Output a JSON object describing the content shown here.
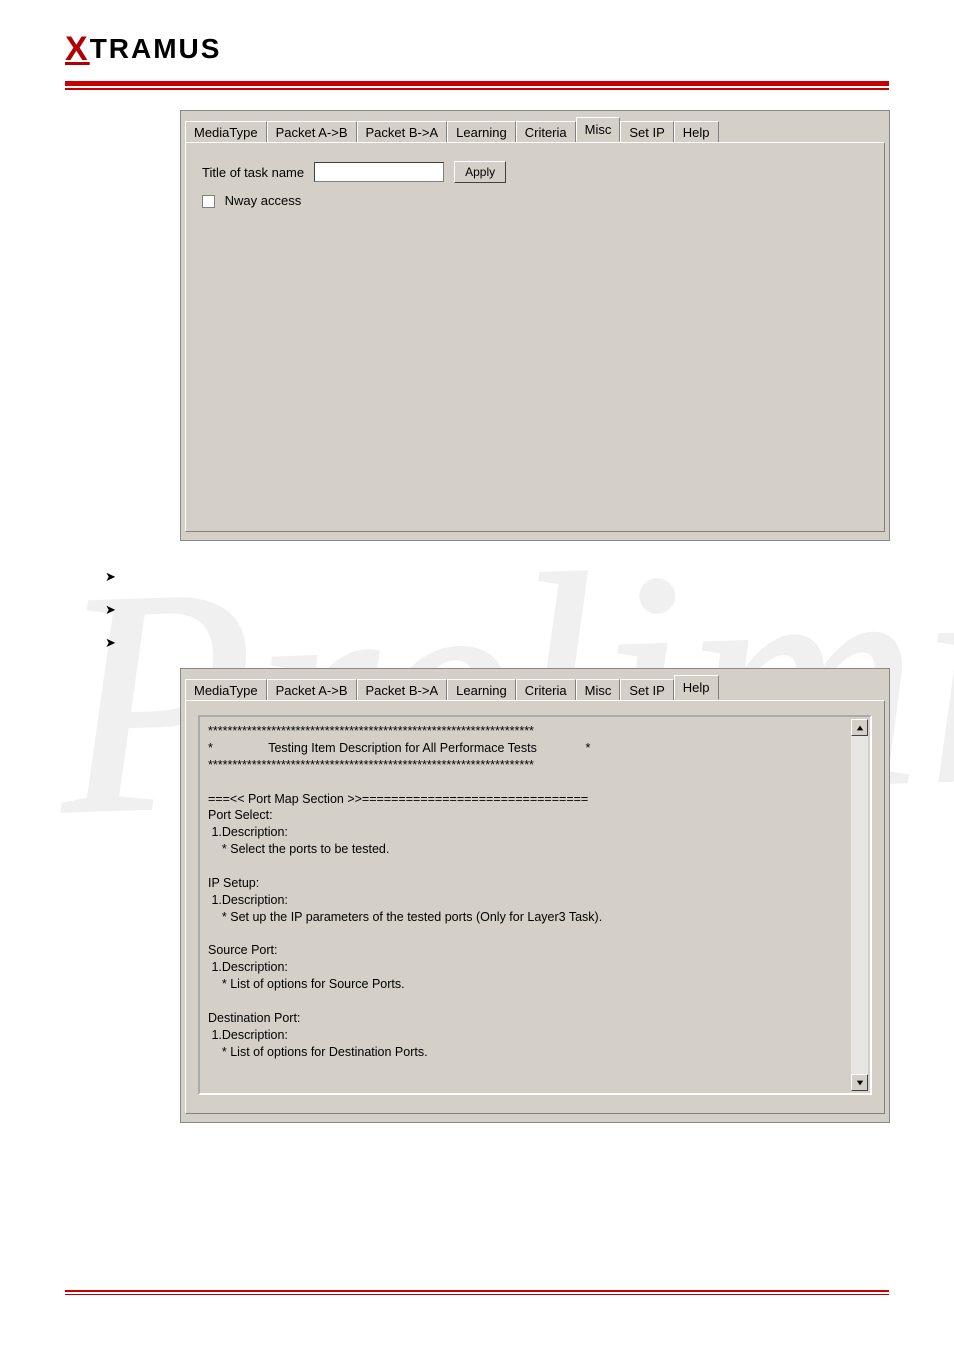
{
  "tabs": {
    "t0": "MediaType",
    "t1": "Packet A->B",
    "t2": "Packet B->A",
    "t3": "Learning",
    "t4": "Criteria",
    "t5": "Misc",
    "t6": "Set IP",
    "t7": "Help"
  },
  "misc": {
    "title_label": "Title of task name",
    "apply_label": "Apply",
    "nway_label": "Nway access"
  },
  "bullets": {
    "b1": "",
    "b2": "",
    "b3": ""
  },
  "help": {
    "text": "*******************************************************************\n*                Testing Item Description for All Performace Tests              *\n*******************************************************************\n\n===<< Port Map Section >>===============================\nPort Select:\n 1.Description:\n    * Select the ports to be tested.\n\nIP Setup:\n 1.Description:\n    * Set up the IP parameters of the tested ports (Only for Layer3 Task).\n\nSource Port:\n 1.Description:\n    * List of options for Source Ports.\n\nDestination Port:\n 1.Description:\n    * List of options for Destination Ports."
  }
}
